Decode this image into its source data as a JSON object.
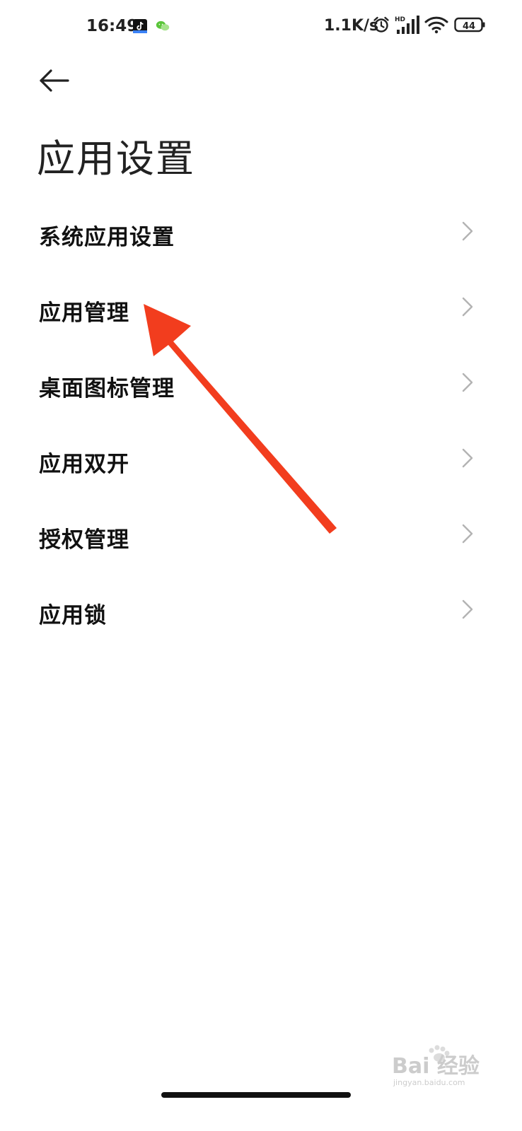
{
  "status_bar": {
    "time": "16:49",
    "net_speed": "1.1K/s",
    "network_type": "HD",
    "battery": "44",
    "icons": [
      "tiktok-icon",
      "wechat-icon",
      "alarm-icon",
      "signal-icon",
      "wifi-icon",
      "battery-icon"
    ]
  },
  "header": {
    "back_icon": "arrow-left-icon",
    "title": "应用设置"
  },
  "menu": {
    "items": [
      {
        "label": "系统应用设置",
        "icon": "chevron-right-icon"
      },
      {
        "label": "应用管理",
        "icon": "chevron-right-icon"
      },
      {
        "label": "桌面图标管理",
        "icon": "chevron-right-icon"
      },
      {
        "label": "应用双开",
        "icon": "chevron-right-icon"
      },
      {
        "label": "授权管理",
        "icon": "chevron-right-icon"
      },
      {
        "label": "应用锁",
        "icon": "chevron-right-icon"
      }
    ]
  },
  "annotation": {
    "color": "#f23d1e",
    "points_to": "应用管理"
  },
  "watermark": {
    "text": "Bai 经验",
    "subtext": "jingyan.baidu.com"
  },
  "colors": {
    "background": "#ffffff",
    "text": "#111111",
    "chevron": "#b3b3b3",
    "arrow": "#f23d1e"
  }
}
